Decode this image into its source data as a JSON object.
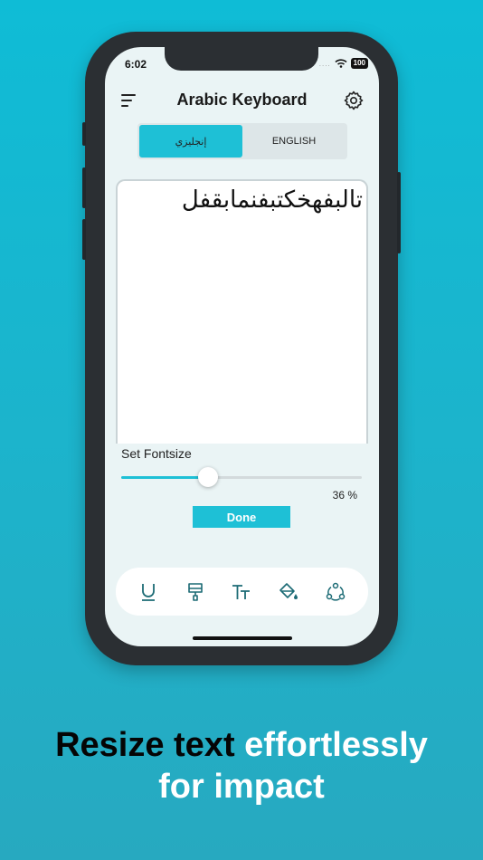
{
  "status": {
    "time": "6:02",
    "battery": "100"
  },
  "header": {
    "title": "Arabic Keyboard"
  },
  "language_toggle": {
    "arabic_label": "إنجليزي",
    "english_label": "ENGLISH",
    "selected": "arabic"
  },
  "editor": {
    "text": "تالبفهخكتبفنمابقفل"
  },
  "fontsize": {
    "label": "Set Fontsize",
    "value_percent": 36,
    "value_text": "36 %",
    "done_label": "Done"
  },
  "toolbar": {
    "items": [
      {
        "icon": "underline-icon"
      },
      {
        "icon": "brush-icon"
      },
      {
        "icon": "font-size-icon"
      },
      {
        "icon": "paint-bucket-icon"
      },
      {
        "icon": "share-icon"
      }
    ]
  },
  "caption": {
    "part1": "Resize text",
    "part2": "effortlessly",
    "line2": "for impact"
  },
  "colors": {
    "accent": "#1ec0d6",
    "background": "#0fbcd6",
    "screen": "#eaf4f5"
  }
}
